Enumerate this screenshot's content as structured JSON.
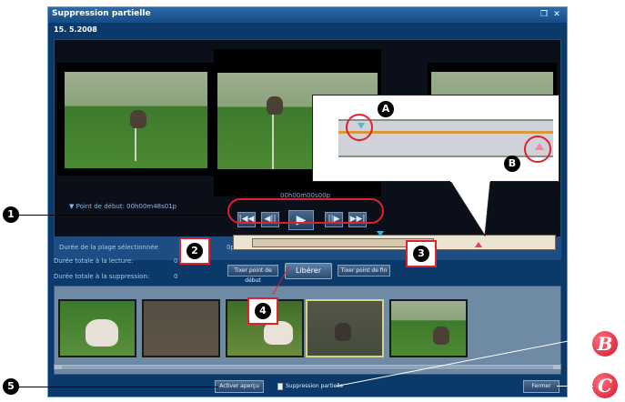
{
  "window": {
    "title": "Suppression partielle",
    "date": "15. 5.2008",
    "controls": {
      "restore_icon": "restore-icon",
      "close_icon": "close-icon"
    }
  },
  "preview": {
    "start_point_label": "▼ Point de début: 00h00m48s01p",
    "current_timecode": "00h00m00s00p"
  },
  "playback_controls": [
    {
      "name": "skip-to-start-button",
      "glyph": "|◀◀"
    },
    {
      "name": "step-back-button",
      "glyph": "◀||"
    },
    {
      "name": "play-button",
      "glyph": "▶"
    },
    {
      "name": "step-forward-button",
      "glyph": "||▶"
    },
    {
      "name": "skip-to-end-button",
      "glyph": "▶▶|"
    }
  ],
  "range": {
    "selected_range_label": "Durée de la plage sélectionnée",
    "selected_range_suffix": "0p",
    "total_playback_label": "Durée totale à la lecture:",
    "total_playback_value": "0",
    "total_deletion_label": "Durée totale à la suppression:",
    "total_deletion_value": "0"
  },
  "buttons": {
    "set_start": "Tixer point de début",
    "delete": "Libérer",
    "set_end": "Tixer point de fin",
    "activate_preview": "Activer aperçu",
    "partial_delete_checkbox": "Suppression partielle",
    "close": "Fermer"
  },
  "callouts": {
    "one": "1",
    "two": "2",
    "three": "3",
    "four": "4",
    "five": "5",
    "A": "A",
    "B": "B",
    "red_B": "B",
    "red_C": "C"
  },
  "colors": {
    "window_bg": "#0b3a6a",
    "titlebar": "#2c6aa8",
    "accent_red": "#e0202a",
    "marker_start": "#3ab0e0",
    "marker_end": "#e04060"
  }
}
